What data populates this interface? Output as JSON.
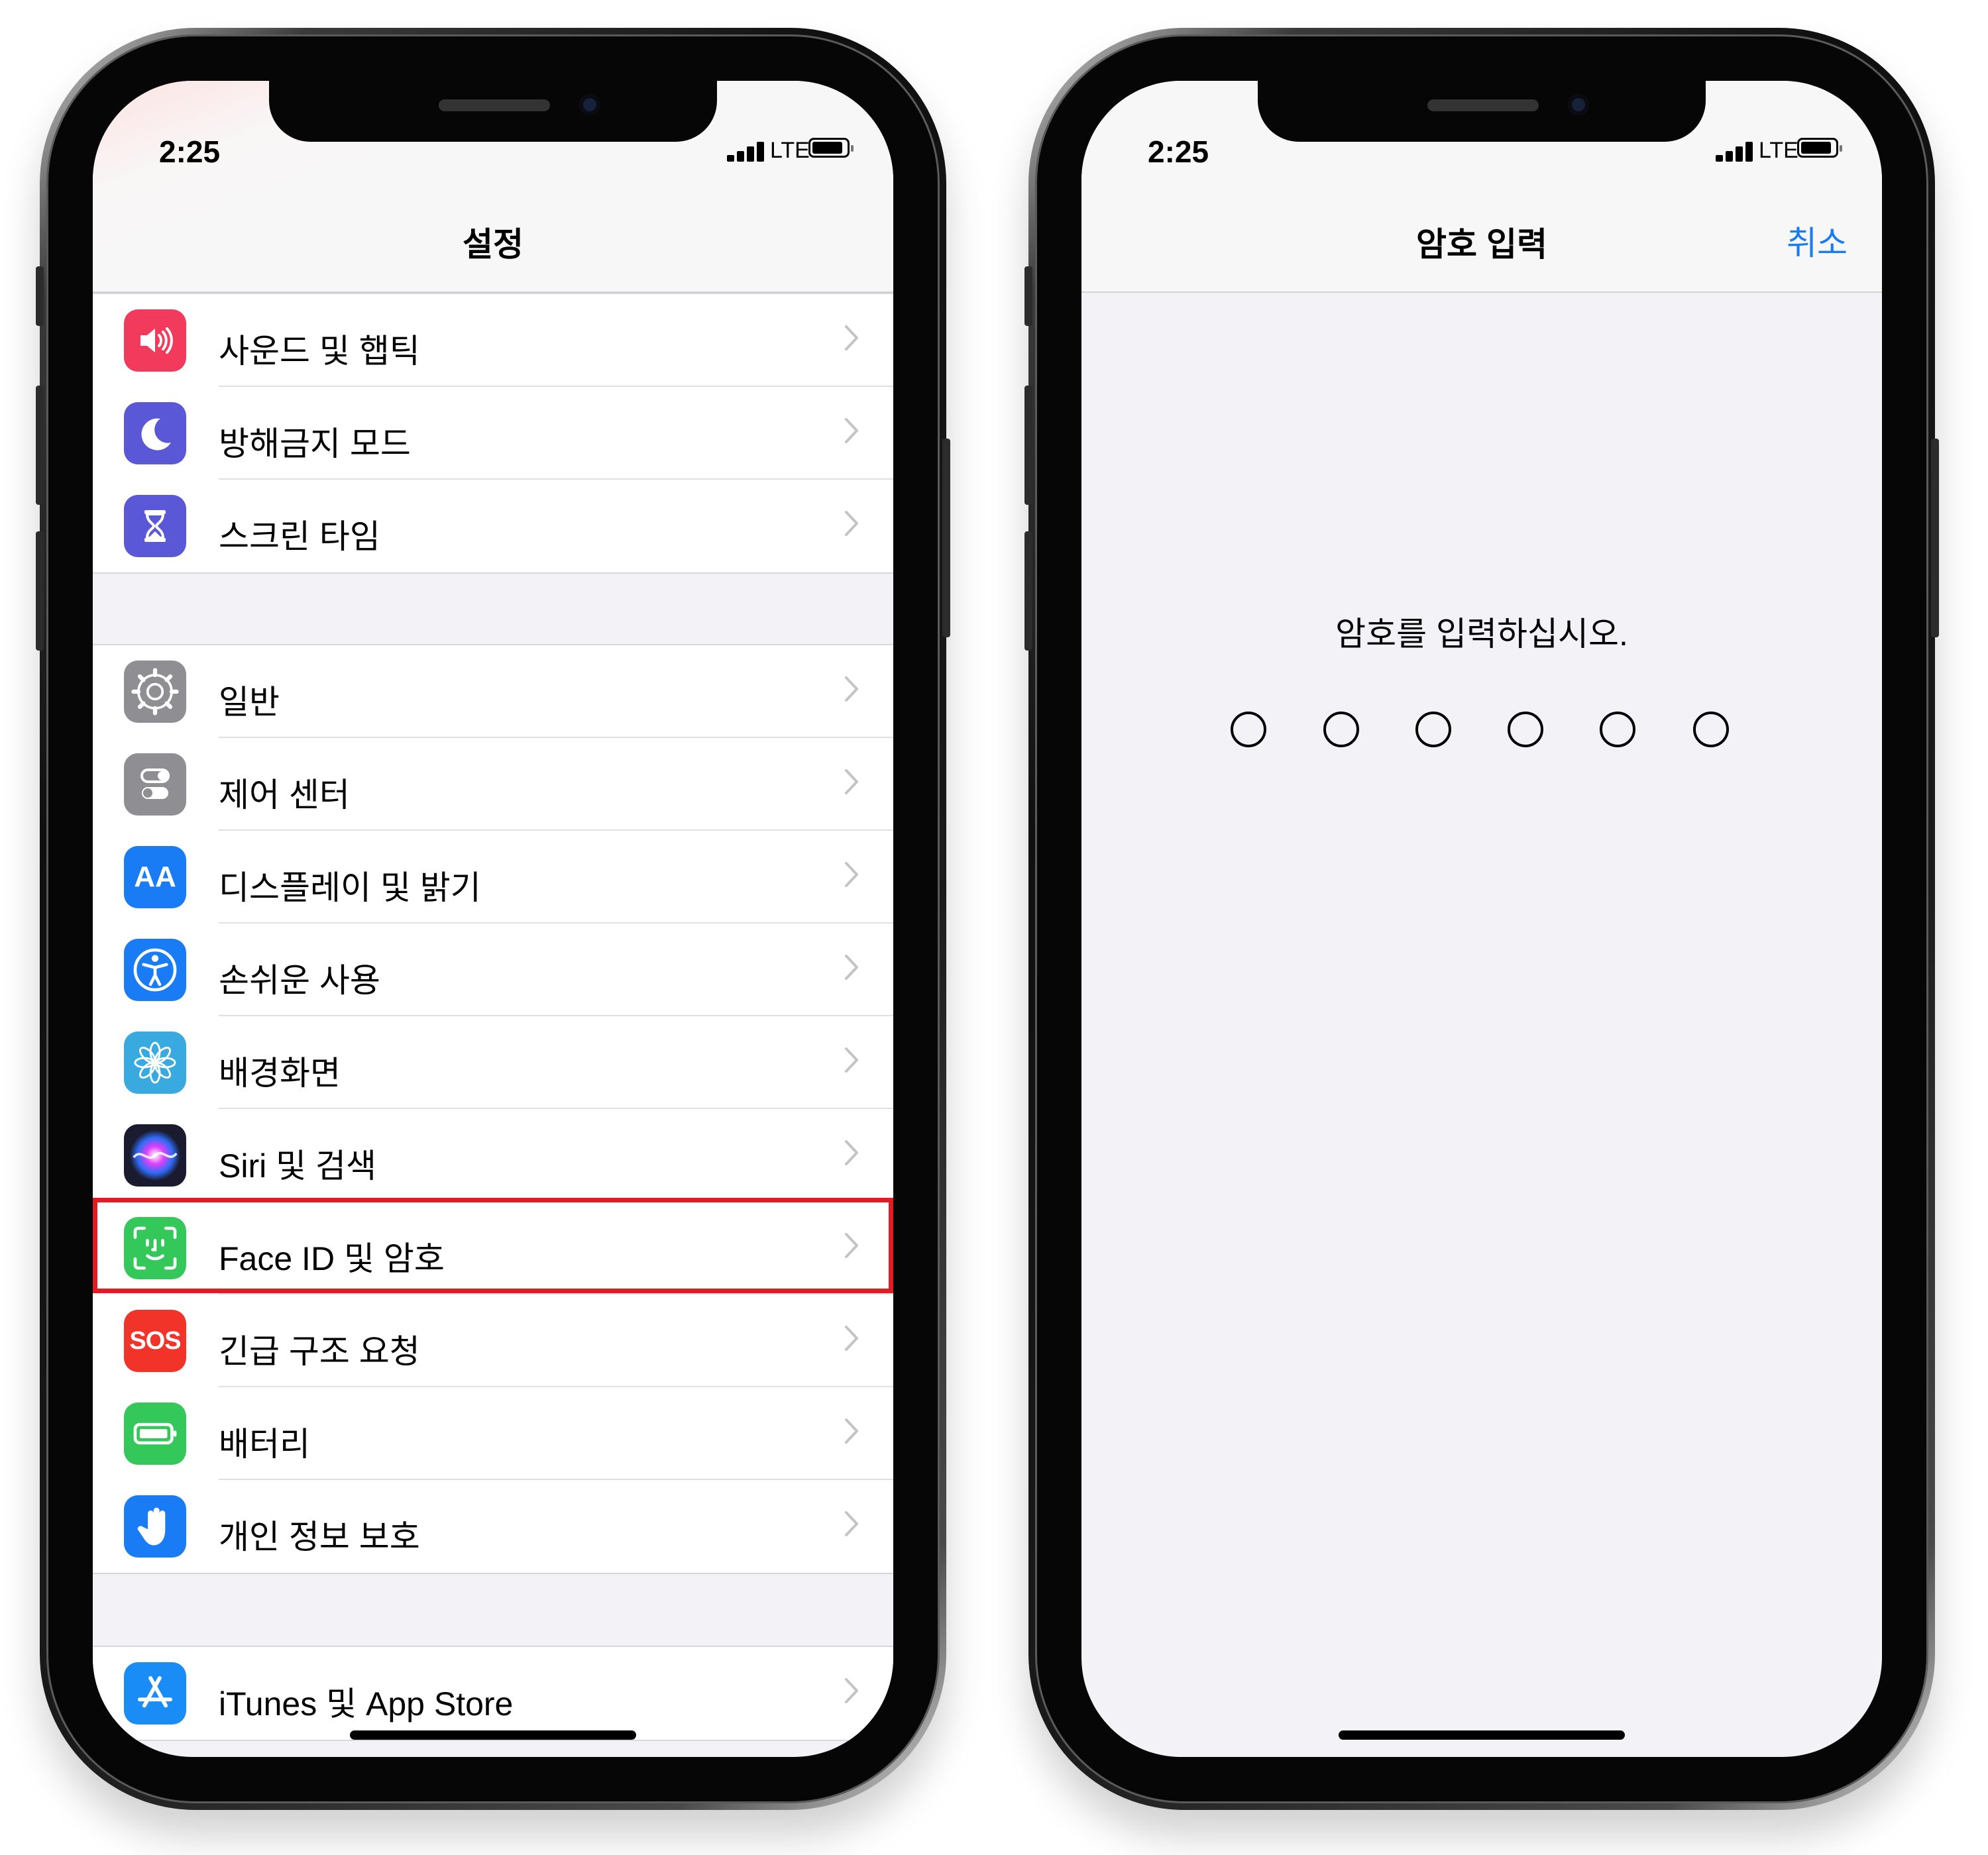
{
  "left_screen": {
    "status": {
      "time": "2:25",
      "network": "LTE"
    },
    "nav": {
      "title": "설정"
    },
    "groups": [
      {
        "items": [
          {
            "label": "사운드 및 햅틱",
            "icon": "speaker-icon",
            "color": "#f23b5c"
          },
          {
            "label": "방해금지 모드",
            "icon": "moon-icon",
            "color": "#5a58d6"
          },
          {
            "label": "스크린 타임",
            "icon": "hourglass-icon",
            "color": "#5a58d6"
          }
        ]
      },
      {
        "items": [
          {
            "label": "일반",
            "icon": "gear-icon",
            "color": "#8e8e93"
          },
          {
            "label": "제어 센터",
            "icon": "toggles-icon",
            "color": "#8e8e93"
          },
          {
            "label": "디스플레이 및 밝기",
            "icon": "text-size-icon",
            "color": "#1a7cf5",
            "glyph": "AA"
          },
          {
            "label": "손쉬운 사용",
            "icon": "accessibility-icon",
            "color": "#1a7cf5"
          },
          {
            "label": "배경화면",
            "icon": "flower-icon",
            "color": "#39aadf"
          },
          {
            "label": "Siri 및 검색",
            "icon": "siri-icon",
            "color": "#1b1b2f"
          },
          {
            "label": "Face ID 및 암호",
            "icon": "face-id-icon",
            "color": "#34c759",
            "highlighted": true
          },
          {
            "label": "긴급 구조 요청",
            "icon": "sos-icon",
            "color": "#f2332a",
            "glyph": "SOS"
          },
          {
            "label": "배터리",
            "icon": "battery-icon",
            "color": "#34c759"
          },
          {
            "label": "개인 정보 보호",
            "icon": "hand-icon",
            "color": "#1a7cf5"
          }
        ]
      },
      {
        "items": [
          {
            "label": "iTunes 및 App Store",
            "icon": "app-store-icon",
            "color": "#1a8cf5"
          }
        ]
      }
    ]
  },
  "right_screen": {
    "status": {
      "time": "2:25",
      "network": "LTE"
    },
    "nav": {
      "title": "암호 입력",
      "cancel": "취소"
    },
    "prompt": "암호를 입력하십시오.",
    "passcode_length": 6
  },
  "colors": {
    "accent": "#1a7cf5",
    "highlight_border": "#e31b22",
    "grouped_background": "#f2f2f7"
  }
}
